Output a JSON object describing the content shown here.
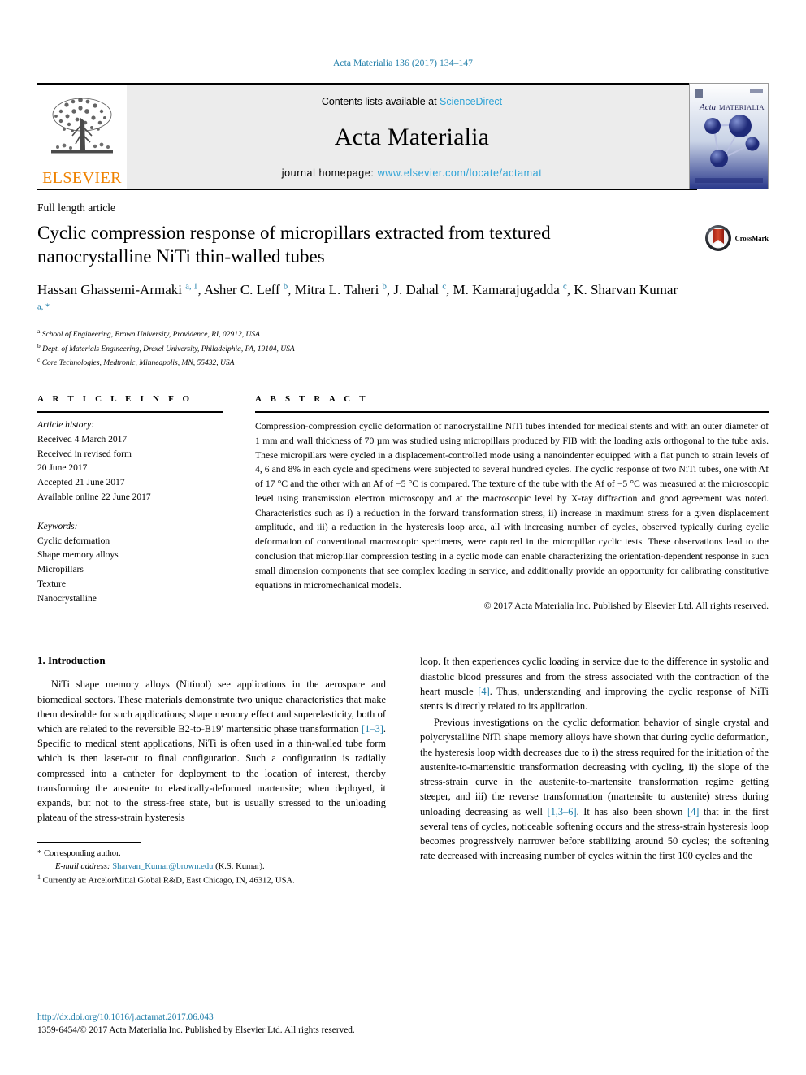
{
  "running_head": "Acta Materialia 136 (2017) 134–147",
  "masthead": {
    "contents_prefix": "Contents lists available at ",
    "sciencedirect": "ScienceDirect",
    "journal_name": "Acta Materialia",
    "homepage_prefix": "journal homepage: ",
    "homepage_url": "www.elsevier.com/locate/actamat",
    "publisher_logo_text": "ELSEVIER",
    "cover_title_italic": "Acta",
    "cover_title_rest": "MATERIALIA",
    "colors": {
      "link": "#2da3d6",
      "running_head": "#1c7ca8",
      "elsevier_orange": "#ef8200",
      "masthead_bg": "#ececec"
    }
  },
  "article": {
    "type": "Full length article",
    "title": "Cyclic compression response of micropillars extracted from textured nanocrystalline NiTi thin-walled tubes",
    "crossmark_label": "CrossMark",
    "authors_html": "Hassan Ghassemi-Armaki <sup>a, 1</sup>, Asher C. Leff <sup>b</sup>, Mitra L. Taheri <sup>b</sup>, J. Dahal <sup>c</sup>, M. Kamarajugadda <sup>c</sup>, K. Sharvan Kumar <sup>a, *</sup>",
    "affiliations": [
      {
        "marker": "a",
        "text": "School of Engineering, Brown University, Providence, RI, 02912, USA"
      },
      {
        "marker": "b",
        "text": "Dept. of Materials Engineering, Drexel University, Philadelphia, PA, 19104, USA"
      },
      {
        "marker": "c",
        "text": "Core Technologies, Medtronic, Minneapolis, MN, 55432, USA"
      }
    ]
  },
  "article_info": {
    "heading": "A R T I C L E  I N F O",
    "history_label": "Article history:",
    "history": [
      "Received 4 March 2017",
      "Received in revised form",
      "20 June 2017",
      "Accepted 21 June 2017",
      "Available online 22 June 2017"
    ],
    "keywords_label": "Keywords:",
    "keywords": [
      "Cyclic deformation",
      "Shape memory alloys",
      "Micropillars",
      "Texture",
      "Nanocrystalline"
    ]
  },
  "abstract": {
    "heading": "A B S T R A C T",
    "text": "Compression-compression cyclic deformation of nanocrystalline NiTi tubes intended for medical stents and with an outer diameter of 1 mm and wall thickness of 70 µm was studied using micropillars produced by FIB with the loading axis orthogonal to the tube axis. These micropillars were cycled in a displacement-controlled mode using a nanoindenter equipped with a flat punch to strain levels of 4, 6 and 8% in each cycle and specimens were subjected to several hundred cycles. The cyclic response of two NiTi tubes, one with Af of 17 °C and the other with an Af of −5 °C is compared. The texture of the tube with the Af of −5 °C was measured at the microscopic level using transmission electron microscopy and at the macroscopic level by X-ray diffraction and good agreement was noted. Characteristics such as i) a reduction in the forward transformation stress, ii) increase in maximum stress for a given displacement amplitude, and iii) a reduction in the hysteresis loop area, all with increasing number of cycles, observed typically during cyclic deformation of conventional macroscopic specimens, were captured in the micropillar cyclic tests. These observations lead to the conclusion that micropillar compression testing in a cyclic mode can enable characterizing the orientation-dependent response in such small dimension components that see complex loading in service, and additionally provide an opportunity for calibrating constitutive equations in micromechanical models.",
    "copyright": "© 2017 Acta Materialia Inc. Published by Elsevier Ltd. All rights reserved."
  },
  "body": {
    "section_heading": "1. Introduction",
    "left_paragraphs": [
      "NiTi shape memory alloys (Nitinol) see applications in the aerospace and biomedical sectors. These materials demonstrate two unique characteristics that make them desirable for such applications; shape memory effect and superelasticity, both of which are related to the reversible B2-to-B19′ martensitic phase transformation [1–3]. Specific to medical stent applications, NiTi is often used in a thin-walled tube form which is then laser-cut to final configuration. Such a configuration is radially compressed into a catheter for deployment to the location of interest, thereby transforming the austenite to elastically-deformed martensite; when deployed, it expands, but not to the stress-free state, but is usually stressed to the unloading plateau of the stress-strain hysteresis"
    ],
    "right_paragraphs": [
      "loop. It then experiences cyclic loading in service due to the difference in systolic and diastolic blood pressures and from the stress associated with the contraction of the heart muscle [4]. Thus, understanding and improving the cyclic response of NiTi stents is directly related to its application.",
      "Previous investigations on the cyclic deformation behavior of single crystal and polycrystalline NiTi shape memory alloys have shown that during cyclic deformation, the hysteresis loop width decreases due to i) the stress required for the initiation of the austenite-to-martensitic transformation decreasing with cycling, ii) the slope of the stress-strain curve in the austenite-to-martensite transformation regime getting steeper, and iii) the reverse transformation (martensite to austenite) stress during unloading decreasing as well [1,3–6]. It has also been shown [4] that in the first several tens of cycles, noticeable softening occurs and the stress-strain hysteresis loop becomes progressively narrower before stabilizing around 50 cycles; the softening rate decreased with increasing number of cycles within the first 100 cycles and the"
    ]
  },
  "footnotes": {
    "corresponding": "* Corresponding author.",
    "email_label": "E-mail address:",
    "email": "Sharvan_Kumar@brown.edu",
    "email_suffix": "(K.S. Kumar).",
    "current_address_marker": "1",
    "current_address": "Currently at: ArcelorMittal Global R&D, East Chicago, IN, 46312, USA."
  },
  "page_footer": {
    "doi": "http://dx.doi.org/10.1016/j.actamat.2017.06.043",
    "issn_line": "1359-6454/© 2017 Acta Materialia Inc. Published by Elsevier Ltd. All rights reserved."
  }
}
